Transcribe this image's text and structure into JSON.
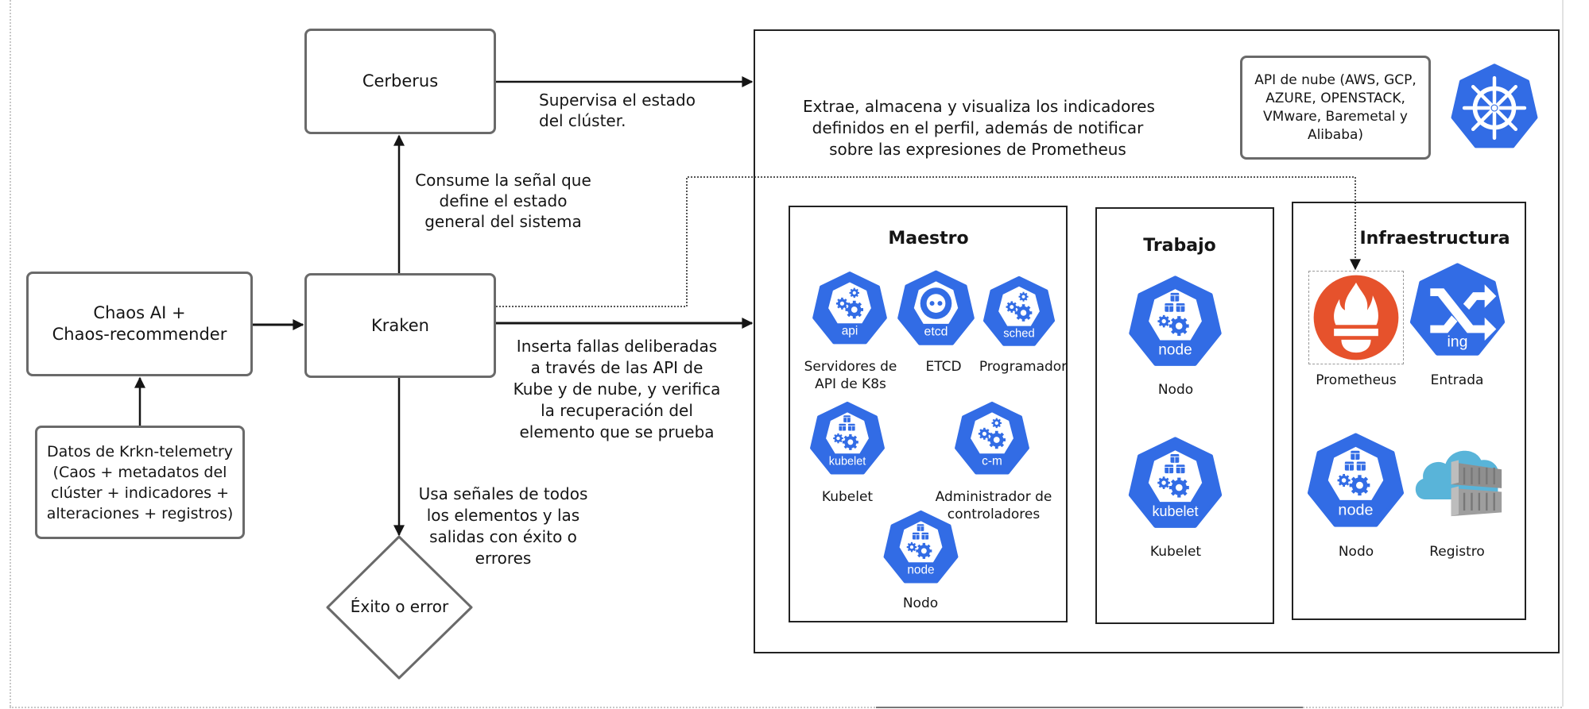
{
  "colors": {
    "k8s_blue": "#326CE5",
    "prometheus_orange": "#E6522C",
    "registry_cloud": "#59B4D9",
    "registry_gray": "#9A9A9A",
    "box_border": "#6A6A6A",
    "line": "#151515"
  },
  "nodes": {
    "cerberus": "Cerberus",
    "kraken": "Kraken",
    "chaos_ai": [
      "Chaos AI +",
      "Chaos-recommender"
    ],
    "telemetry": [
      "Datos de Krkn-telemetry",
      "(Caos + metadatos del",
      "clúster + indicadores +",
      "alteraciones + registros)"
    ],
    "decision": "Éxito o error",
    "cloud_api": [
      "API de nube (AWS, GCP,",
      "AZURE, OPENSTACK,",
      "VMware, Baremetal y",
      "Alibaba)"
    ]
  },
  "edge_labels": {
    "cerberus_monitor": [
      "Supervisa el estado",
      "del clúster."
    ],
    "consume_signal": [
      "Consume la señal que",
      "define el estado",
      "general del sistema"
    ],
    "inject_faults": [
      "Inserta fallas deliberadas",
      "a través de las API de",
      "Kube y de nube, y verifica",
      "la recuperación del",
      "elemento que se prueba"
    ],
    "use_signals": [
      "Usa señales de todos",
      "los elementos y las",
      "salidas con éxito o",
      "errores"
    ],
    "prometheus_note": [
      "Extrae, almacena y visualiza los indicadores",
      "definidos en el perfil, además de notificar",
      "sobre las expresiones de Prometheus"
    ]
  },
  "groups": {
    "master": {
      "title": "Maestro",
      "items": [
        {
          "icon": "api",
          "badge": "api",
          "label": [
            "Servidores de",
            "API de K8s"
          ]
        },
        {
          "icon": "etcd",
          "badge": "etcd",
          "label": [
            "ETCD"
          ]
        },
        {
          "icon": "sched",
          "badge": "sched",
          "label": [
            "Programador"
          ]
        },
        {
          "icon": "kubelet",
          "badge": "kubelet",
          "label": [
            "Kubelet"
          ]
        },
        {
          "icon": "c-m",
          "badge": "c-m",
          "label": [
            "Administrador de",
            "controladores"
          ]
        },
        {
          "icon": "node",
          "badge": "node",
          "label": [
            "Nodo"
          ]
        }
      ]
    },
    "worker": {
      "title": "Trabajo",
      "items": [
        {
          "icon": "node",
          "badge": "node",
          "label": [
            "Nodo"
          ]
        },
        {
          "icon": "kubelet",
          "badge": "kubelet",
          "label": [
            "Kubelet"
          ]
        }
      ]
    },
    "infra": {
      "title": "Infraestructura",
      "items": [
        {
          "icon": "prometheus",
          "badge": "",
          "label": [
            "Prometheus"
          ]
        },
        {
          "icon": "ingress",
          "badge": "ing",
          "label": [
            "Entrada"
          ]
        },
        {
          "icon": "node",
          "badge": "node",
          "label": [
            "Nodo"
          ]
        },
        {
          "icon": "registry",
          "badge": "",
          "label": [
            "Registro"
          ]
        }
      ]
    }
  },
  "logo": "kubernetes-helm-icon"
}
